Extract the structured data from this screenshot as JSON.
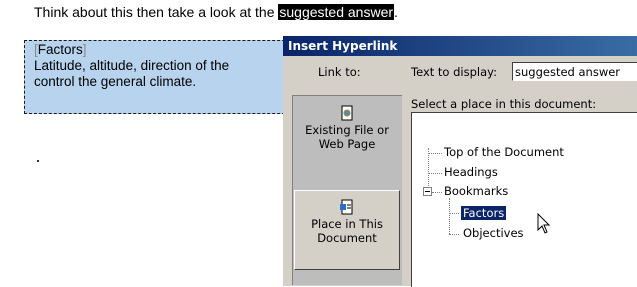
{
  "instruction": {
    "before": "Think about this then take a look at the ",
    "highlight": "suggested answer",
    "after": "."
  },
  "textbox": {
    "bracket_open": "[",
    "heading": "Factors",
    "bracket_close": "]",
    "line1": "Latitude, altitude, direction of the",
    "line2": "control the general climate."
  },
  "dialog": {
    "title": "Insert Hyperlink",
    "link_to_label": "Link to:",
    "text_to_display_label": "Text to display:",
    "text_to_display_value": "suggested answer",
    "select_place_label": "Select a place in this document:",
    "link_buttons": [
      {
        "line1": "Existing File or",
        "line2": "Web Page",
        "icon": "document-icon"
      },
      {
        "line1": "Place in This",
        "line2": "Document",
        "icon": "bookmark-document-icon"
      }
    ],
    "tree": {
      "top": "Top of the Document",
      "headings": "Headings",
      "bookmarks": "Bookmarks",
      "children": [
        "Factors",
        "Objectives"
      ],
      "selected": "Factors"
    }
  }
}
